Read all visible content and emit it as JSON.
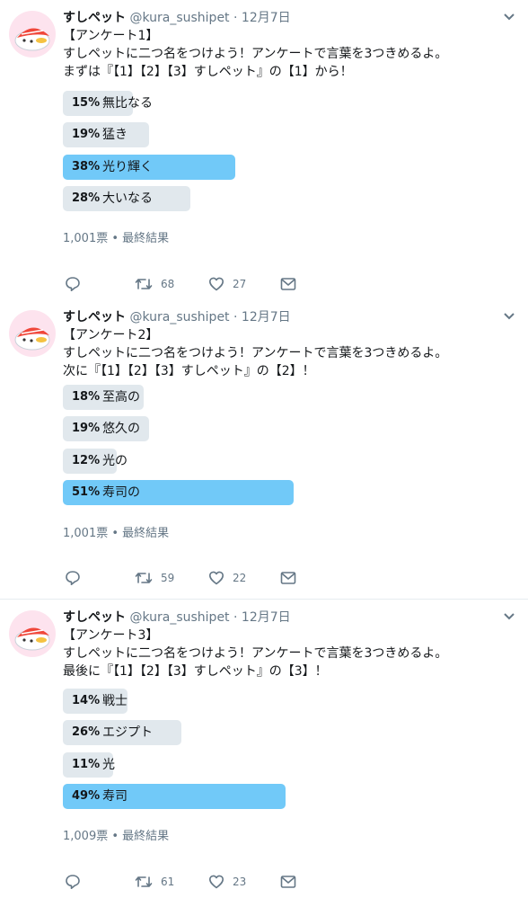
{
  "tweets": [
    {
      "name": "すしペット",
      "handle": "@kura_sushipet",
      "dot": "·",
      "date": "12月7日",
      "text": "【アンケート1】\nすしペットに二つ名をつけよう！アンケートで言葉を3つきめるよ。\nまずは『【1】【2】【3】すしペット』の【1】から！",
      "options": [
        {
          "percent": "15%",
          "label": "無比なる",
          "value": 15
        },
        {
          "percent": "19%",
          "label": "猛き",
          "value": 19
        },
        {
          "percent": "38%",
          "label": "光り輝く",
          "value": 38,
          "winner": true
        },
        {
          "percent": "28%",
          "label": "大いなる",
          "value": 28
        }
      ],
      "votes": "1,001票",
      "status": "最終結果",
      "retweets": "68",
      "likes": "27"
    },
    {
      "name": "すしペット",
      "handle": "@kura_sushipet",
      "dot": "·",
      "date": "12月7日",
      "text": "【アンケート2】\nすしペットに二つ名をつけよう！アンケートで言葉を3つきめるよ。\n次に『【1】【2】【3】すしペット』の【2】！",
      "options": [
        {
          "percent": "18%",
          "label": "至高の",
          "value": 18
        },
        {
          "percent": "19%",
          "label": "悠久の",
          "value": 19
        },
        {
          "percent": "12%",
          "label": "光の",
          "value": 12
        },
        {
          "percent": "51%",
          "label": "寿司の",
          "value": 51,
          "winner": true
        }
      ],
      "votes": "1,001票",
      "status": "最終結果",
      "retweets": "59",
      "likes": "22"
    },
    {
      "name": "すしペット",
      "handle": "@kura_sushipet",
      "dot": "·",
      "date": "12月7日",
      "text": "【アンケート3】\nすしペットに二つ名をつけよう！アンケートで言葉を3つきめるよ。\n最後に『【1】【2】【3】すしペット』の【3】！",
      "options": [
        {
          "percent": "14%",
          "label": "戦士",
          "value": 14
        },
        {
          "percent": "26%",
          "label": "エジプト",
          "value": 26
        },
        {
          "percent": "11%",
          "label": "光",
          "value": 11
        },
        {
          "percent": "49%",
          "label": "寿司",
          "value": 49,
          "winner": true
        }
      ],
      "votes": "1,009票",
      "status": "最終結果",
      "retweets": "61",
      "likes": "23"
    }
  ],
  "icons": {
    "reply": "reply-icon",
    "retweet": "retweet-icon",
    "like": "heart-icon",
    "dm": "envelope-icon",
    "caret": "chevron-down-icon"
  },
  "colors": {
    "poll_winner": "#71c9f8",
    "poll_other": "#e1e8ed",
    "secondary_text": "#657786",
    "avatar_bg": "#fde3ee"
  }
}
